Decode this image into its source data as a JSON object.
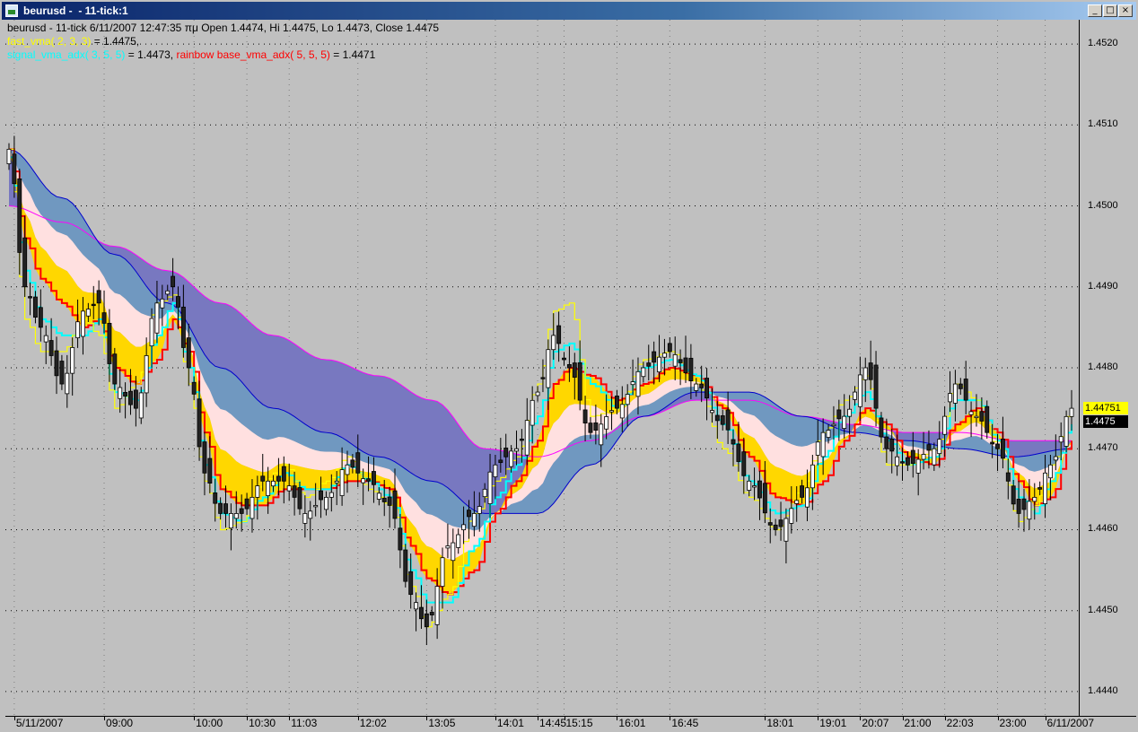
{
  "window": {
    "title": "beurusd -  - 11-tick:1",
    "controls": [
      "_",
      "□",
      "×"
    ]
  },
  "legend": {
    "line1": "beurusd - 11-tick 6/11/2007 12:47:35 πμ Open 1.4474, Hi 1.4475, Lo 1.4473, Close 1.4475",
    "fast_label": "fast_vma( 2, 3, 3)",
    "fast_value": " = 1.4475,",
    "signal_label": "signal_vma_adx( 3, 5, 5)",
    "signal_value": " = 1.4473, ",
    "rainbow_label": "rainbow base_vma_adx( 5, 5, 5)",
    "rainbow_value": " = 1.4471"
  },
  "price_tags": {
    "yellow": "1.44751",
    "black": "1.4475"
  },
  "colors": {
    "background": "#c0c0c0",
    "fast": "#ffff00",
    "signal": "#00ffff",
    "rainbow": "#ff0000",
    "slow_blue": "#0000cc",
    "slowest_magenta": "#ff00ff",
    "band_gold": "#ffd700",
    "band_pink": "#ffe0e0",
    "band_steel": "#7098c0",
    "band_slate": "#7878c0"
  },
  "chart_data": {
    "type": "candlestick",
    "ylim": [
      1.4437,
      1.4523
    ],
    "yticks": [
      "1.4520",
      "1.4510",
      "1.4500",
      "1.4490",
      "1.4480",
      "1.4470",
      "1.4460",
      "1.4450",
      "1.4440"
    ],
    "ytick_values": [
      1.452,
      1.451,
      1.45,
      1.449,
      1.448,
      1.447,
      1.446,
      1.445,
      1.444
    ],
    "xticks": [
      "5/11/2007",
      "09:00",
      "10:00",
      "10:30",
      "11:03",
      "12:02",
      "13:05",
      "14:01",
      "14:45",
      "15:15",
      "16:01",
      "16:45",
      "18:01",
      "19:01",
      "20:07",
      "21:00",
      "22:03",
      "23:00",
      "6/11/2007"
    ],
    "xtick_bars": [
      1,
      18,
      35,
      45,
      53,
      66,
      79,
      92,
      100,
      105,
      115,
      125,
      143,
      153,
      161,
      169,
      177,
      187,
      196
    ],
    "bar_count": 202,
    "keypoints": {
      "close": [
        [
          0,
          1.4507
        ],
        [
          3,
          1.449
        ],
        [
          6,
          1.4485
        ],
        [
          10,
          1.4478
        ],
        [
          14,
          1.4487
        ],
        [
          17,
          1.4488
        ],
        [
          20,
          1.4478
        ],
        [
          24,
          1.4475
        ],
        [
          28,
          1.4488
        ],
        [
          31,
          1.449
        ],
        [
          34,
          1.448
        ],
        [
          37,
          1.4467
        ],
        [
          40,
          1.4462
        ],
        [
          44,
          1.4462
        ],
        [
          48,
          1.4466
        ],
        [
          52,
          1.4466
        ],
        [
          56,
          1.4462
        ],
        [
          60,
          1.4464
        ],
        [
          64,
          1.4468
        ],
        [
          68,
          1.4466
        ],
        [
          72,
          1.4463
        ],
        [
          76,
          1.4452
        ],
        [
          79,
          1.4448
        ],
        [
          83,
          1.4458
        ],
        [
          88,
          1.4462
        ],
        [
          92,
          1.4468
        ],
        [
          96,
          1.447
        ],
        [
          100,
          1.4477
        ],
        [
          103,
          1.4484
        ],
        [
          106,
          1.448
        ],
        [
          110,
          1.4472
        ],
        [
          115,
          1.4475
        ],
        [
          120,
          1.448
        ],
        [
          125,
          1.4482
        ],
        [
          130,
          1.4478
        ],
        [
          135,
          1.4473
        ],
        [
          140,
          1.4466
        ],
        [
          145,
          1.446
        ],
        [
          150,
          1.4464
        ],
        [
          154,
          1.4472
        ],
        [
          158,
          1.4474
        ],
        [
          162,
          1.448
        ],
        [
          166,
          1.447
        ],
        [
          170,
          1.4468
        ],
        [
          175,
          1.447
        ],
        [
          179,
          1.4478
        ],
        [
          183,
          1.4474
        ],
        [
          187,
          1.447
        ],
        [
          191,
          1.4462
        ],
        [
          194,
          1.4464
        ],
        [
          197,
          1.4468
        ],
        [
          201,
          1.4475
        ]
      ],
      "fast_vma": [
        [
          0,
          1.4507
        ],
        [
          3,
          1.4486
        ],
        [
          6,
          1.4482
        ],
        [
          10,
          1.4482
        ],
        [
          14,
          1.4486
        ],
        [
          17,
          1.4484
        ],
        [
          20,
          1.4475
        ],
        [
          24,
          1.4478
        ],
        [
          28,
          1.4488
        ],
        [
          31,
          1.4489
        ],
        [
          34,
          1.4478
        ],
        [
          37,
          1.4466
        ],
        [
          40,
          1.446
        ],
        [
          44,
          1.4461
        ],
        [
          48,
          1.4466
        ],
        [
          52,
          1.4468
        ],
        [
          56,
          1.4464
        ],
        [
          60,
          1.4466
        ],
        [
          64,
          1.4469
        ],
        [
          68,
          1.4465
        ],
        [
          72,
          1.4463
        ],
        [
          76,
          1.4453
        ],
        [
          79,
          1.4448
        ],
        [
          83,
          1.4452
        ],
        [
          88,
          1.4462
        ],
        [
          92,
          1.4466
        ],
        [
          96,
          1.4469
        ],
        [
          100,
          1.4478
        ],
        [
          103,
          1.4487
        ],
        [
          106,
          1.4488
        ],
        [
          110,
          1.4474
        ],
        [
          115,
          1.4475
        ],
        [
          120,
          1.4481
        ],
        [
          125,
          1.4482
        ],
        [
          130,
          1.4478
        ],
        [
          135,
          1.447
        ],
        [
          140,
          1.4464
        ],
        [
          145,
          1.446
        ],
        [
          150,
          1.4465
        ],
        [
          154,
          1.4472
        ],
        [
          158,
          1.4476
        ],
        [
          162,
          1.4479
        ],
        [
          166,
          1.4468
        ],
        [
          170,
          1.4468
        ],
        [
          175,
          1.447
        ],
        [
          179,
          1.4478
        ],
        [
          183,
          1.4476
        ],
        [
          187,
          1.447
        ],
        [
          191,
          1.4461
        ],
        [
          194,
          1.4463
        ],
        [
          197,
          1.4468
        ],
        [
          201,
          1.4475
        ]
      ],
      "signal_vma": [
        [
          0,
          1.4506
        ],
        [
          3,
          1.4492
        ],
        [
          6,
          1.4486
        ],
        [
          10,
          1.4484
        ],
        [
          14,
          1.4484
        ],
        [
          17,
          1.4486
        ],
        [
          20,
          1.4477
        ],
        [
          24,
          1.4476
        ],
        [
          28,
          1.4484
        ],
        [
          31,
          1.4488
        ],
        [
          34,
          1.448
        ],
        [
          37,
          1.4468
        ],
        [
          40,
          1.4462
        ],
        [
          44,
          1.4461
        ],
        [
          48,
          1.4464
        ],
        [
          52,
          1.4467
        ],
        [
          56,
          1.4465
        ],
        [
          60,
          1.4465
        ],
        [
          64,
          1.4468
        ],
        [
          68,
          1.4466
        ],
        [
          72,
          1.4464
        ],
        [
          76,
          1.4455
        ],
        [
          79,
          1.4451
        ],
        [
          83,
          1.4451
        ],
        [
          88,
          1.4458
        ],
        [
          92,
          1.4464
        ],
        [
          96,
          1.4468
        ],
        [
          100,
          1.4474
        ],
        [
          103,
          1.4482
        ],
        [
          106,
          1.4483
        ],
        [
          110,
          1.4478
        ],
        [
          115,
          1.4475
        ],
        [
          120,
          1.448
        ],
        [
          125,
          1.4481
        ],
        [
          130,
          1.4479
        ],
        [
          135,
          1.4473
        ],
        [
          140,
          1.4466
        ],
        [
          145,
          1.4462
        ],
        [
          150,
          1.4463
        ],
        [
          154,
          1.4469
        ],
        [
          158,
          1.4474
        ],
        [
          162,
          1.4477
        ],
        [
          166,
          1.4471
        ],
        [
          170,
          1.4468
        ],
        [
          175,
          1.4469
        ],
        [
          179,
          1.4476
        ],
        [
          183,
          1.4476
        ],
        [
          187,
          1.4471
        ],
        [
          191,
          1.4464
        ],
        [
          194,
          1.4462
        ],
        [
          197,
          1.4466
        ],
        [
          201,
          1.4473
        ]
      ],
      "rainbow_base": [
        [
          0,
          1.4507
        ],
        [
          3,
          1.4496
        ],
        [
          6,
          1.4491
        ],
        [
          10,
          1.4488
        ],
        [
          14,
          1.4485
        ],
        [
          17,
          1.4486
        ],
        [
          20,
          1.448
        ],
        [
          24,
          1.4478
        ],
        [
          28,
          1.4481
        ],
        [
          31,
          1.4486
        ],
        [
          34,
          1.4482
        ],
        [
          37,
          1.4472
        ],
        [
          40,
          1.4465
        ],
        [
          44,
          1.4463
        ],
        [
          48,
          1.4463
        ],
        [
          52,
          1.4465
        ],
        [
          56,
          1.4465
        ],
        [
          60,
          1.4465
        ],
        [
          64,
          1.4466
        ],
        [
          68,
          1.4466
        ],
        [
          72,
          1.4465
        ],
        [
          76,
          1.4458
        ],
        [
          79,
          1.4454
        ],
        [
          83,
          1.4452
        ],
        [
          88,
          1.4455
        ],
        [
          92,
          1.4462
        ],
        [
          96,
          1.4466
        ],
        [
          100,
          1.4471
        ],
        [
          103,
          1.4478
        ],
        [
          106,
          1.448
        ],
        [
          110,
          1.4479
        ],
        [
          115,
          1.4476
        ],
        [
          120,
          1.4478
        ],
        [
          125,
          1.448
        ],
        [
          130,
          1.4479
        ],
        [
          135,
          1.4475
        ],
        [
          140,
          1.4469
        ],
        [
          145,
          1.4464
        ],
        [
          150,
          1.4463
        ],
        [
          154,
          1.4466
        ],
        [
          158,
          1.4471
        ],
        [
          162,
          1.4475
        ],
        [
          166,
          1.4473
        ],
        [
          170,
          1.4469
        ],
        [
          175,
          1.4468
        ],
        [
          179,
          1.4473
        ],
        [
          183,
          1.4475
        ],
        [
          187,
          1.4472
        ],
        [
          191,
          1.4466
        ],
        [
          194,
          1.4463
        ],
        [
          197,
          1.4464
        ],
        [
          201,
          1.4471
        ]
      ],
      "slow_blue": [
        [
          0,
          1.4507
        ],
        [
          10,
          1.4501
        ],
        [
          20,
          1.4494
        ],
        [
          30,
          1.4488
        ],
        [
          40,
          1.448
        ],
        [
          50,
          1.4475
        ],
        [
          60,
          1.4472
        ],
        [
          70,
          1.4469
        ],
        [
          80,
          1.4466
        ],
        [
          90,
          1.4462
        ],
        [
          100,
          1.4462
        ],
        [
          110,
          1.4468
        ],
        [
          120,
          1.4474
        ],
        [
          130,
          1.4477
        ],
        [
          140,
          1.4477
        ],
        [
          150,
          1.4474
        ],
        [
          160,
          1.4472
        ],
        [
          170,
          1.4471
        ],
        [
          180,
          1.447
        ],
        [
          190,
          1.4469
        ],
        [
          201,
          1.447
        ]
      ],
      "slowest_magenta": [
        [
          0,
          1.45
        ],
        [
          10,
          1.4498
        ],
        [
          20,
          1.4495
        ],
        [
          30,
          1.4492
        ],
        [
          40,
          1.4488
        ],
        [
          50,
          1.4484
        ],
        [
          60,
          1.4481
        ],
        [
          70,
          1.4479
        ],
        [
          80,
          1.4476
        ],
        [
          90,
          1.447
        ],
        [
          100,
          1.4469
        ],
        [
          110,
          1.4471
        ],
        [
          120,
          1.4474
        ],
        [
          130,
          1.4476
        ],
        [
          140,
          1.4476
        ],
        [
          150,
          1.4474
        ],
        [
          160,
          1.4473
        ],
        [
          170,
          1.4472
        ],
        [
          180,
          1.4472
        ],
        [
          190,
          1.4471
        ],
        [
          201,
          1.4471
        ]
      ]
    },
    "candle_range": 0.00035,
    "wick_extra": 0.00025
  }
}
